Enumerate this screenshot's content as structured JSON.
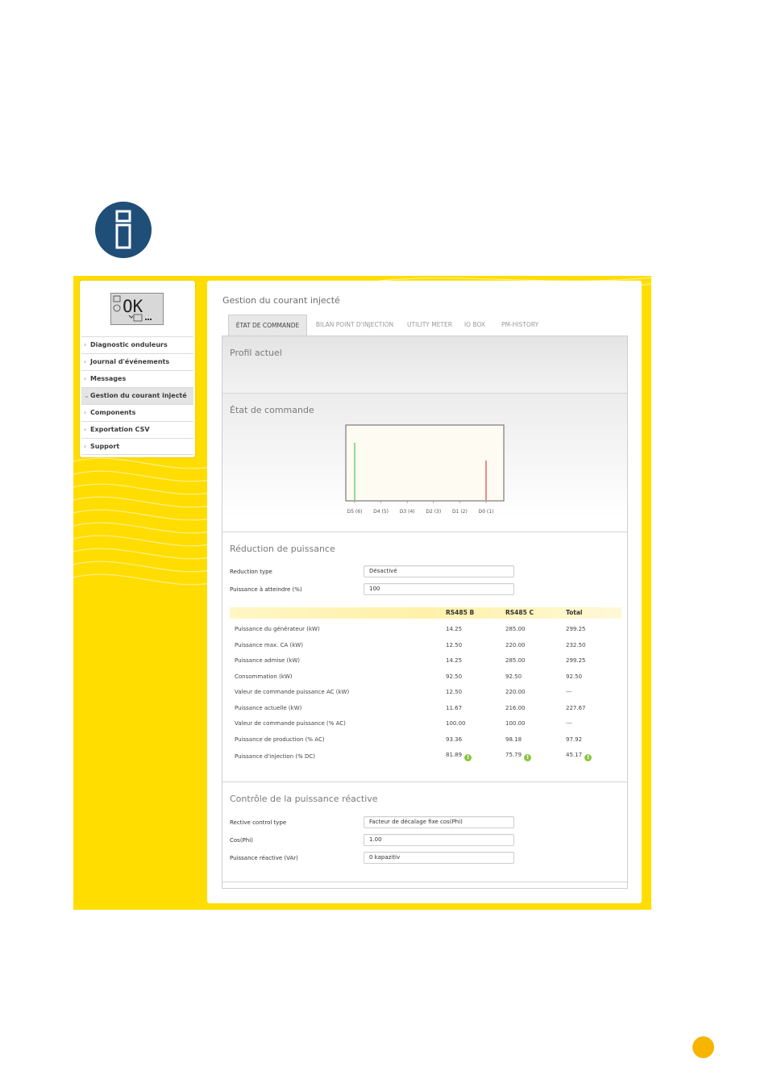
{
  "sidebar": {
    "lcd_text": "OK",
    "items": [
      {
        "label": "Diagnostic onduleurs",
        "chevron": "›"
      },
      {
        "label": "Journal d'événements",
        "chevron": "›"
      },
      {
        "label": "Messages",
        "chevron": "›"
      },
      {
        "label": "Gestion du courant injecté",
        "chevron": "⌄",
        "active": true
      },
      {
        "label": "Components",
        "chevron": "›"
      },
      {
        "label": "Exportation CSV",
        "chevron": "›"
      },
      {
        "label": "Support",
        "chevron": "›"
      }
    ]
  },
  "main": {
    "title": "Gestion du courant injecté",
    "tabs": [
      {
        "label": "ÉTAT DE COMMANDE",
        "active": true
      },
      {
        "label": "BILAN POINT D'INJECTION"
      },
      {
        "label": "UTILITY METER"
      },
      {
        "label": "IO BOX"
      },
      {
        "label": "PM-HISTORY"
      }
    ]
  },
  "profil": {
    "title": "Profil actuel"
  },
  "etat": {
    "title": "État de commande",
    "chart_data": {
      "type": "bar",
      "categories": [
        "D5 (6)",
        "D4 (5)",
        "D3 (4)",
        "D2 (3)",
        "D1 (2)",
        "D0 (1)"
      ],
      "markers": [
        {
          "category": "D5 (6)",
          "color": "#5cc85c"
        },
        {
          "category": "D0 (1)",
          "color": "#e05050"
        }
      ]
    }
  },
  "reduction": {
    "title": "Réduction de puissance",
    "type_label": "Reduction type",
    "type_value": "Désactivé",
    "target_label": "Puissance à atteindre (%)",
    "target_value": "100",
    "table": {
      "headers": [
        "",
        "RS485 B",
        "RS485 C",
        "Total"
      ],
      "rows": [
        {
          "label": "Puissance du générateur (kW)",
          "b": "14.25",
          "c": "285.00",
          "t": "299.25"
        },
        {
          "label": "Puissance max. CA (kW)",
          "b": "12.50",
          "c": "220.00",
          "t": "232.50"
        },
        {
          "label": "Puissance admise (kW)",
          "b": "14.25",
          "c": "285.00",
          "t": "299.25"
        },
        {
          "label": "Consommation (kW)",
          "b": "92.50",
          "c": "92.50",
          "t": "92.50"
        },
        {
          "label": "Valeur de commande puissance AC (kW)",
          "b": "12.50",
          "c": "220.00",
          "t": "---"
        },
        {
          "label": "Puissance actuelle (kW)",
          "b": "11.67",
          "c": "216.00",
          "t": "227.67"
        },
        {
          "label": "Valeur de commande puissance (% AC)",
          "b": "100.00",
          "c": "100.00",
          "t": "---"
        },
        {
          "label": "Puissance de production (% AC)",
          "b": "93.36",
          "c": "98.18",
          "t": "97.92"
        },
        {
          "label": "Puissance d'injection (% DC)",
          "b": "81.89",
          "c": "75.79",
          "t": "45.17",
          "warn": true
        }
      ]
    }
  },
  "reactive": {
    "title": "Contrôle de la puissance réactive",
    "type_label": "Rective control type",
    "type_value": "Facteur de décalage fixe cos(Phi)",
    "cos_label": "Cos(Phi)",
    "cos_value": "1.00",
    "var_label": "Puissance réactive (VAr)",
    "var_value": "0 kapazitiv"
  },
  "icons": {
    "info": "info-icon",
    "warning": "warning-icon"
  },
  "colors": {
    "panel": "#ffdd00",
    "info_circle": "#1f4e79",
    "page_dot": "#f7b500",
    "ok_marker": "#5cc85c",
    "alert_marker": "#e05050"
  }
}
